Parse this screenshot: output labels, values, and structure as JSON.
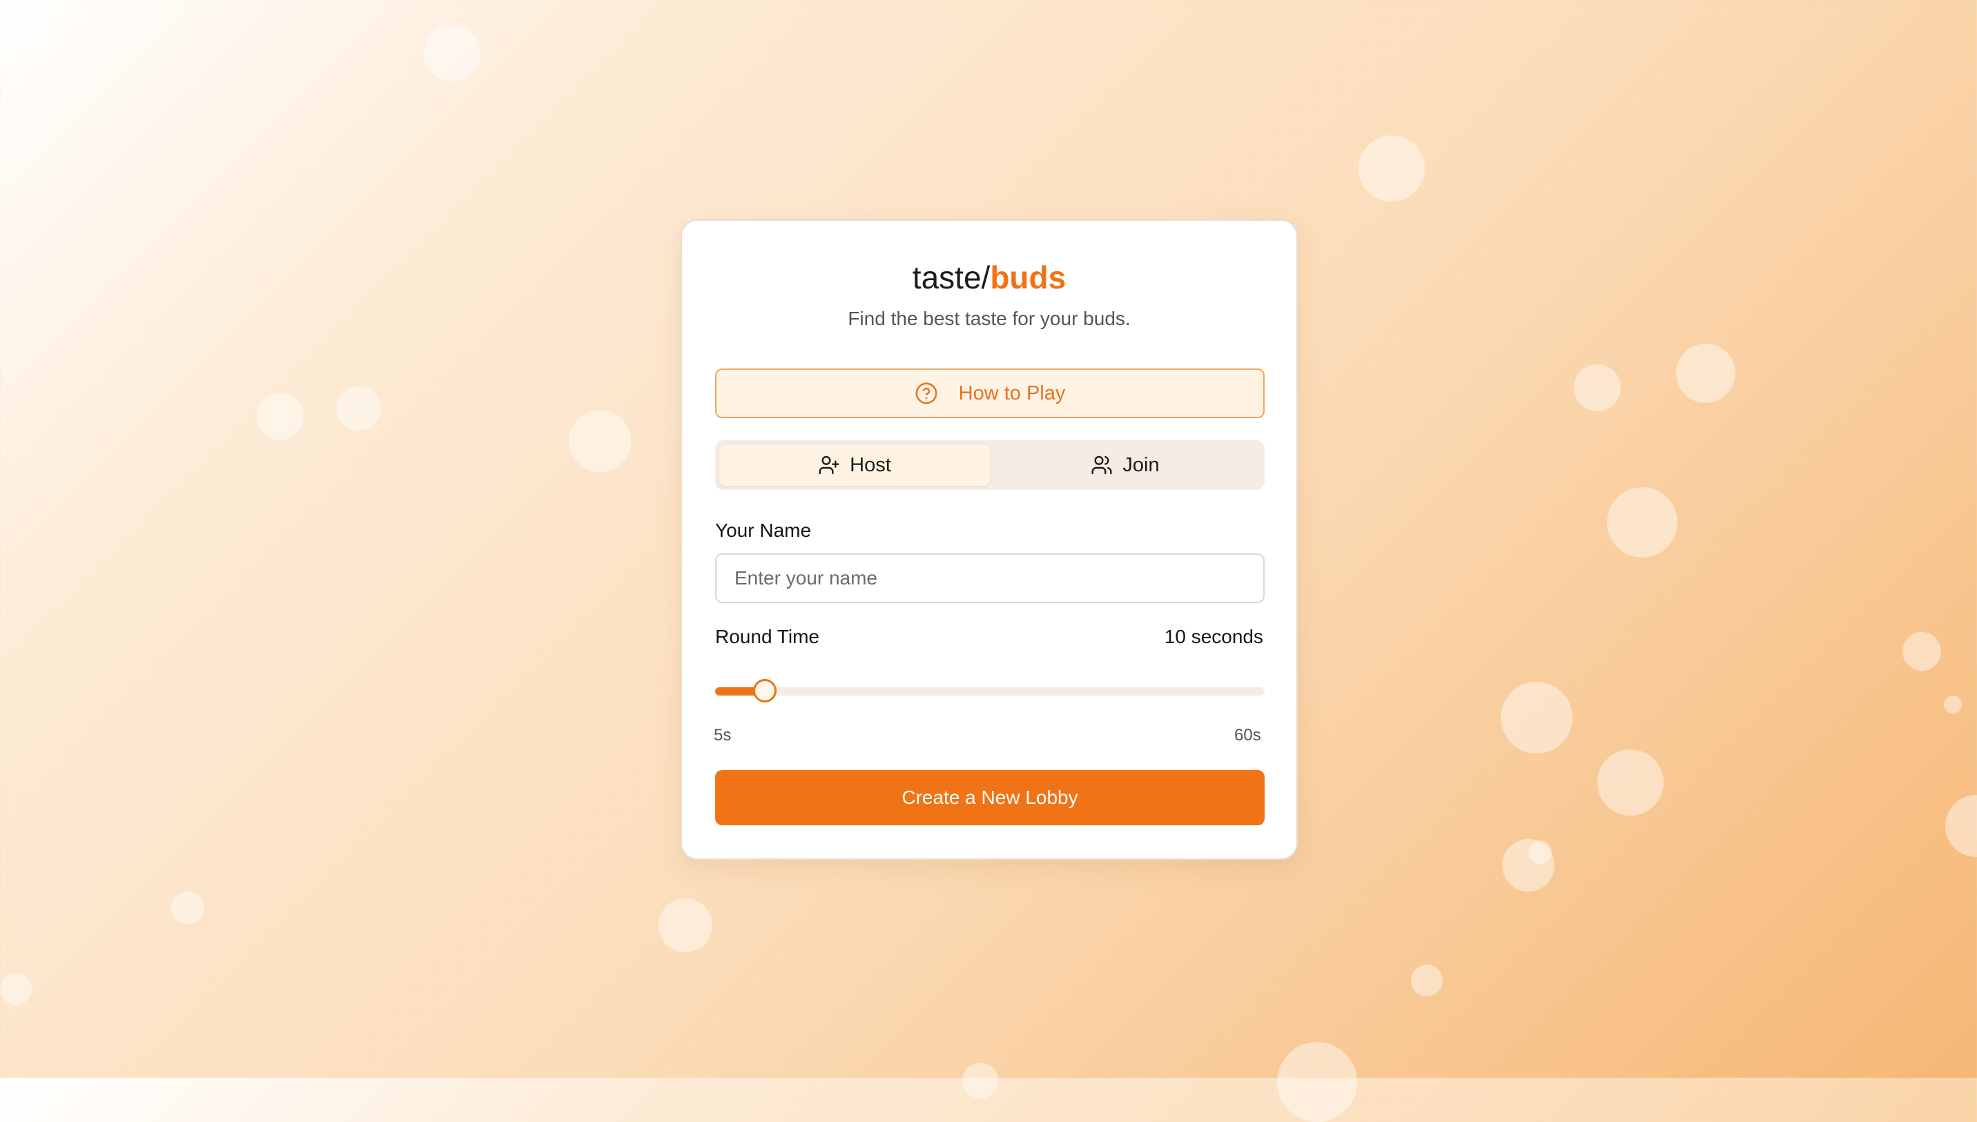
{
  "app": {
    "title_prefix": "taste/",
    "title_accent": "buds",
    "subtitle": "Find the best taste for your buds."
  },
  "how_to_play": {
    "label": "How to Play",
    "icon": "help-circle-icon"
  },
  "tabs": [
    {
      "label": "Host",
      "icon": "user-plus-icon",
      "active": true
    },
    {
      "label": "Join",
      "icon": "users-icon",
      "active": false
    }
  ],
  "name_field": {
    "label": "Your Name",
    "placeholder": "Enter your name",
    "value": ""
  },
  "round_time": {
    "label": "Round Time",
    "value_text": "10 seconds",
    "value": 10,
    "min": 5,
    "max": 60,
    "min_label": "5s",
    "max_label": "60s"
  },
  "create_button": {
    "label": "Create a New Lobby"
  },
  "colors": {
    "accent": "#f07316",
    "howto_bg": "#fff4e4",
    "tab_active_bg": "#fff4e3",
    "tabs_bg": "#f4ece5"
  }
}
